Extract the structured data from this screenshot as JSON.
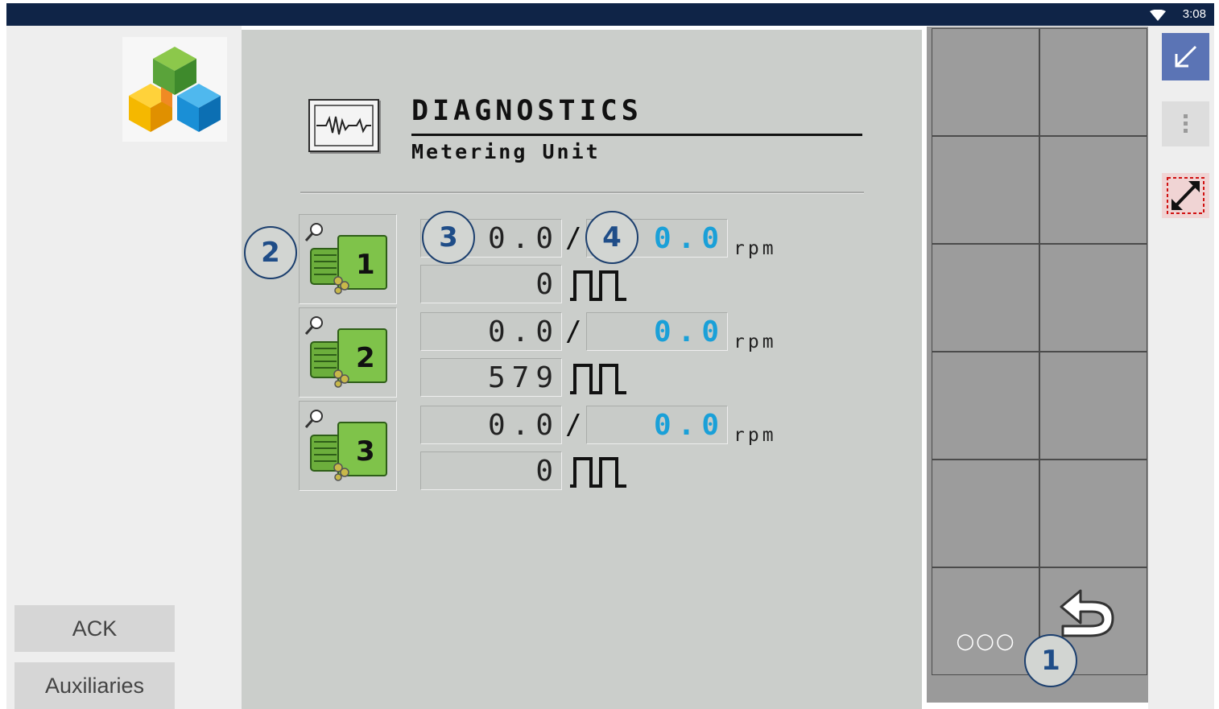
{
  "status_bar": {
    "time": "3:08",
    "wifi_icon": "wifi-icon"
  },
  "left_panel": {
    "logo_icon": "isobus-cube-logo",
    "buttons": [
      {
        "label": "ACK"
      },
      {
        "label": "Auxiliaries"
      }
    ]
  },
  "main": {
    "icon": "ecg-waveform-icon",
    "title": "DIAGNOSTICS",
    "subtitle": "Metering Unit",
    "units": [
      {
        "number": "1",
        "actual_rpm": "0.0",
        "target_rpm": "0.0",
        "pulses": "0"
      },
      {
        "number": "2",
        "actual_rpm": "0.0",
        "target_rpm": "0.0",
        "pulses": "579"
      },
      {
        "number": "3",
        "actual_rpm": "0.0",
        "target_rpm": "0.0",
        "pulses": "0"
      }
    ],
    "separator": "/",
    "unit_label": "rpm",
    "pulse_icon": "pulse-train-icon"
  },
  "callouts": [
    "1",
    "2",
    "3",
    "4"
  ],
  "softkeys": {
    "more_label": "○○○",
    "back_icon": "back-arrow-icon"
  },
  "right_rail": {
    "minimize_icon": "minimize-arrow-icon",
    "overflow_icon": "more-vert-icon",
    "resize_icon": "resize-icon"
  },
  "colors": {
    "status_bar": "#0f2447",
    "main_bg": "#cbcecb",
    "softkey_bg": "#9c9c9c",
    "accent_cyan": "#1aa0d8",
    "callout": "#1c3f6e",
    "minimize_btn": "#5b74b5"
  }
}
